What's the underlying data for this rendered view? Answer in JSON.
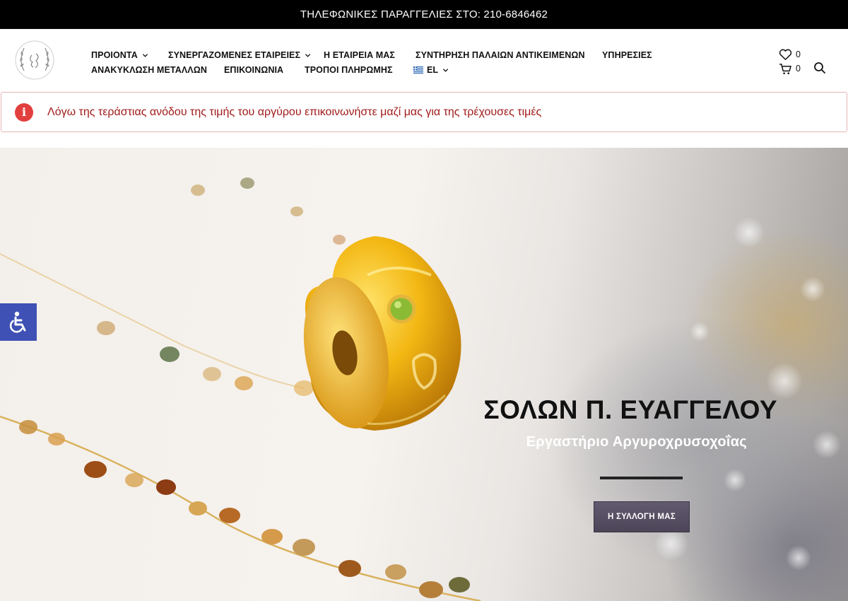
{
  "topbar": {
    "text": "ΤΗΛΕΦΩΝΙΚΕΣ ΠΑΡΑΓΓΕΛΙΕΣ ΣΤΟ: 210-6846462"
  },
  "nav": {
    "row1": [
      {
        "label": "ΠΡΟΙΟΝΤΑ",
        "dropdown": true
      },
      {
        "label": "ΣΥΝΕΡΓΑΖΟΜΕΝΕΣ ΕΤΑΙΡΕΙΕΣ",
        "dropdown": true
      },
      {
        "label": "Η ΕΤΑΙΡΕΙΑ ΜΑΣ",
        "dropdown": false
      },
      {
        "label": "ΣΥΝΤΗΡΗΣΗ ΠΑΛΑΙΩΝ ΑΝΤΙΚΕΙΜΕΝΩΝ",
        "dropdown": false
      },
      {
        "label": "ΥΠΗΡΕΣΙΕΣ",
        "dropdown": false
      }
    ],
    "row2": [
      {
        "label": "ΑΝΑΚΥΚΛΩΣΗ ΜΕΤΑΛΛΩΝ",
        "dropdown": false
      },
      {
        "label": "ΕΠΙΚΟΙΝΩΝΙΑ",
        "dropdown": false
      },
      {
        "label": "ΤΡΟΠΟΙ ΠΛΗΡΩΜΗΣ",
        "dropdown": false
      }
    ],
    "language": {
      "label": "EL",
      "icon": "greek-flag-icon"
    }
  },
  "header_icons": {
    "wishlist_count": "0",
    "cart_count": "0"
  },
  "notice": {
    "icon": "info-icon",
    "icon_glyph": "i",
    "text": "Λόγω της τεράστιας ανόδου της τιμής του αργύρου επικοινωνήστε μαζί μας για της τρέχουσες τιμές"
  },
  "hero": {
    "title": "ΣΟΛΩΝ Π. ΕΥΑΓΓΕΛΟΥ",
    "subtitle": "Εργαστήριο Αργυροχρυσοχοΐας",
    "button_label": "Η ΣΥΛΛΟΓΗ ΜΑΣ"
  },
  "colors": {
    "topbar_bg": "#000000",
    "notice_border": "#e8b4b8",
    "notice_text": "#a01b1b",
    "notice_icon": "#e2403f",
    "button_bg": "#574f63",
    "accessibility_bg": "#3f51b5"
  }
}
